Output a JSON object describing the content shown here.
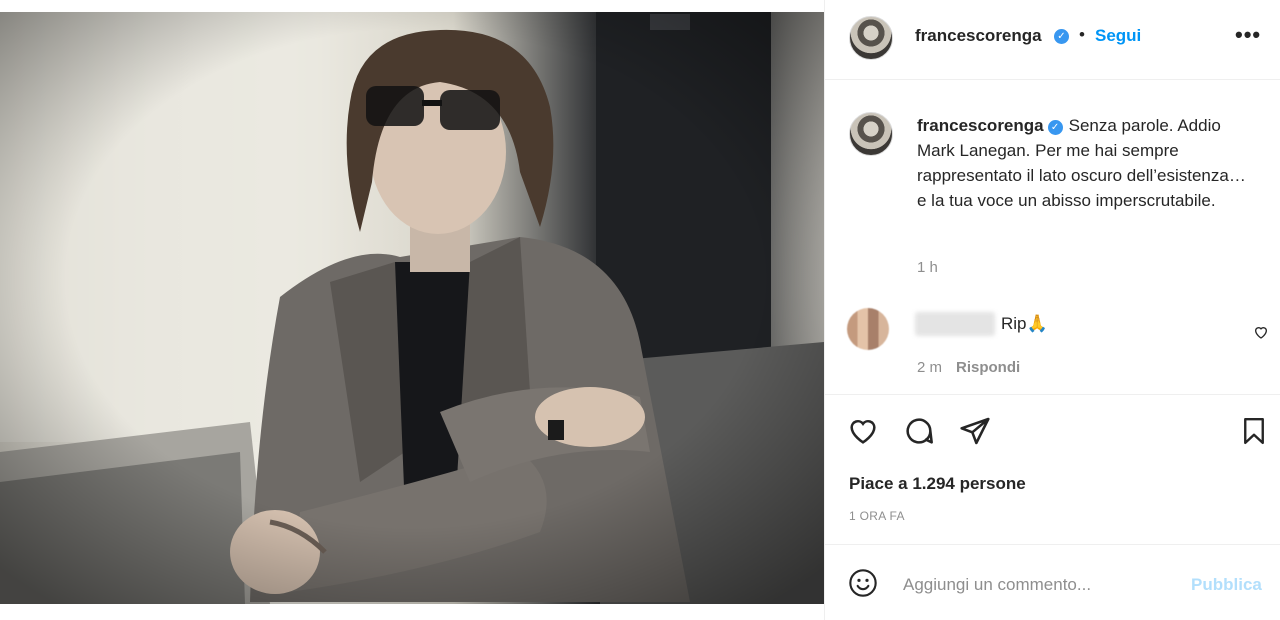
{
  "post": {
    "image_alt": "",
    "author": "francescorenga",
    "verified_mark": "✓",
    "separator": "•",
    "follow_label": "Segui",
    "more_label": "•••"
  },
  "caption": {
    "author": "francescorenga",
    "text": "Senza parole. Addio Mark Lanegan. Per me hai sempre rappresentato il lato oscuro dell’esistenza… e la tua voce un abisso imperscrutabile.",
    "time": "1 h"
  },
  "comment": {
    "text": "Rip🙏",
    "time": "2 m",
    "reply_label": "Rispondi"
  },
  "actions": {
    "like_icon": "heart-outline",
    "comment_icon": "speech-bubble",
    "share_icon": "paper-plane",
    "save_icon": "bookmark"
  },
  "likes_text": "Piace a 1.294 persone",
  "timestamp": "1 ORA FA",
  "comment_box": {
    "emoji_icon": "smiley-face",
    "placeholder": "Aggiungi un commento...",
    "publish_label": "Pubblica"
  },
  "colors": {
    "link_blue": "#0095f6",
    "publish_disabled": "#b2dffc",
    "muted": "#8e8e8e",
    "verified_blue": "#3897f0"
  }
}
